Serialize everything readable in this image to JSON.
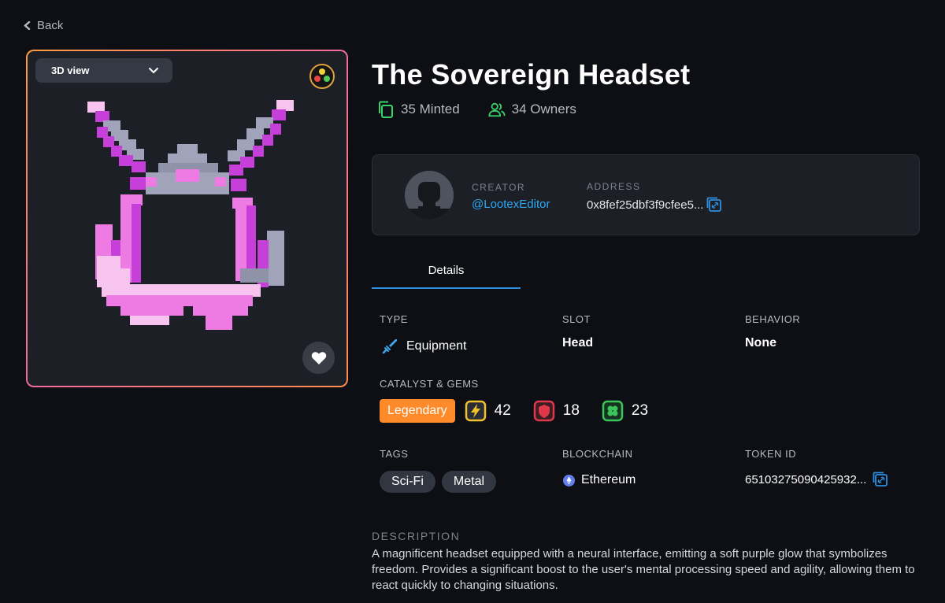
{
  "nav": {
    "back_label": "Back"
  },
  "viewer": {
    "view_mode": "3D view"
  },
  "item": {
    "title": "The Sovereign Headset",
    "minted": "35 Minted",
    "owners": "34 Owners"
  },
  "creator": {
    "creator_label": "CREATOR",
    "handle": "@LootexEditor",
    "address_label": "ADDRESS",
    "address": "0x8fef25dbf3f9cfee5..."
  },
  "tabs": [
    {
      "label": "Details"
    }
  ],
  "details": {
    "type_label": "TYPE",
    "type_value": "Equipment",
    "slot_label": "SLOT",
    "slot_value": "Head",
    "behavior_label": "BEHAVIOR",
    "behavior_value": "None",
    "catalyst_label": "CATALYST & GEMS",
    "rarity": "Legendary",
    "gems": [
      {
        "icon": "lightning-gem-icon",
        "value": "42",
        "color": "#f2c12e"
      },
      {
        "icon": "shield-gem-icon",
        "value": "18",
        "color": "#e0384b"
      },
      {
        "icon": "clover-gem-icon",
        "value": "23",
        "color": "#3bc45a"
      }
    ],
    "tags_label": "TAGS",
    "tags": [
      "Sci-Fi",
      "Metal"
    ],
    "blockchain_label": "BLOCKCHAIN",
    "blockchain_value": "Ethereum",
    "token_label": "TOKEN ID",
    "token_value": "65103275090425932..."
  },
  "description": {
    "label": "DESCRIPTION",
    "text": "A magnificent headset equipped with a neural interface, emitting a soft purple glow that symbolizes freedom. Provides a significant boost to the user's mental processing speed and agility, allowing them to react quickly to changing situations."
  },
  "colors": {
    "accent_blue": "#2fa8f2",
    "rarity_orange": "#ff8a2a",
    "stats_green": "#39d36b",
    "background": "#0d0f14"
  }
}
